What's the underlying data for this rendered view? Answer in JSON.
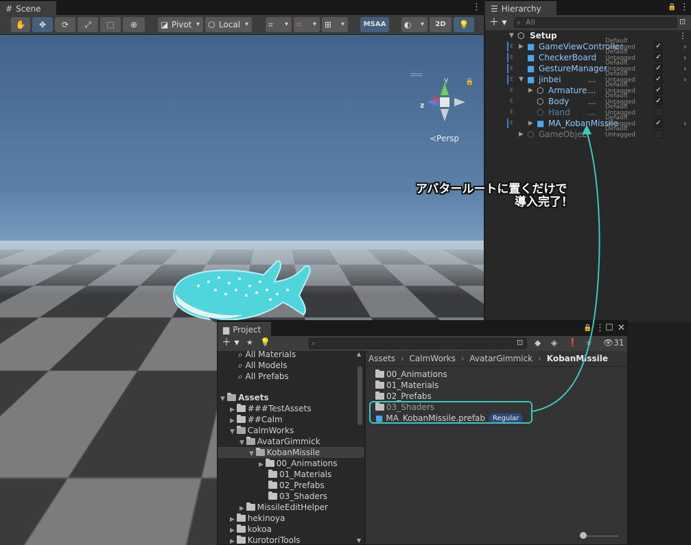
{
  "scene": {
    "tab_label": "Scene",
    "toolbar": {
      "pivot_label": "Pivot",
      "local_label": "Local",
      "msaa_label": "MSAA",
      "twod_label": "2D"
    },
    "gizmo": {
      "z_label": "z",
      "y_label": "y",
      "persp_label": "≺Persp"
    }
  },
  "hierarchy": {
    "tab_label": "Hierarchy",
    "search_placeholder": "All",
    "root": "Setup",
    "tag_default": "Default",
    "tag_untagged": "Untagged",
    "items": [
      {
        "label": "GameViewController",
        "dots": ""
      },
      {
        "label": "CheckerBoard",
        "dots": ""
      },
      {
        "label": "GestureManager",
        "dots": ""
      },
      {
        "label": "jinbei",
        "dots": "..."
      },
      {
        "label": "Armature",
        "dots": "..."
      },
      {
        "label": "Body",
        "dots": "..."
      },
      {
        "label": "Hand",
        "dots": "..."
      },
      {
        "label": "MA_KobanMissile",
        "dots": ""
      },
      {
        "label": "GameObjec",
        "dots": "..."
      }
    ]
  },
  "annotation": {
    "line1": "アバタールートに置くだけで",
    "line2": "導入完了！"
  },
  "project": {
    "tab_label": "Project",
    "hidden_count": "31",
    "breadcrumb": [
      "Assets",
      "CalmWorks",
      "AvatarGimmick",
      "KobanMissile"
    ],
    "tree": [
      {
        "label": "All Materials"
      },
      {
        "label": "All Models"
      },
      {
        "label": "All Prefabs"
      },
      {
        "label": "Assets"
      },
      {
        "label": "###TestAssets"
      },
      {
        "label": "##Calm"
      },
      {
        "label": "CalmWorks"
      },
      {
        "label": "AvatarGimmick"
      },
      {
        "label": "KobanMissile"
      },
      {
        "label": "00_Animations"
      },
      {
        "label": "01_Materials"
      },
      {
        "label": "02_Prefabs"
      },
      {
        "label": "03_Shaders"
      },
      {
        "label": "MissileEditHelper"
      },
      {
        "label": "hekinoya"
      },
      {
        "label": "kokoa"
      },
      {
        "label": "KurotoriTools"
      }
    ],
    "files": [
      {
        "label": "00_Animations"
      },
      {
        "label": "01_Materials"
      },
      {
        "label": "02_Prefabs"
      },
      {
        "label": "03_Shaders"
      },
      {
        "label": "MA_KobanMissile.prefab",
        "badge": "Regular"
      }
    ]
  }
}
